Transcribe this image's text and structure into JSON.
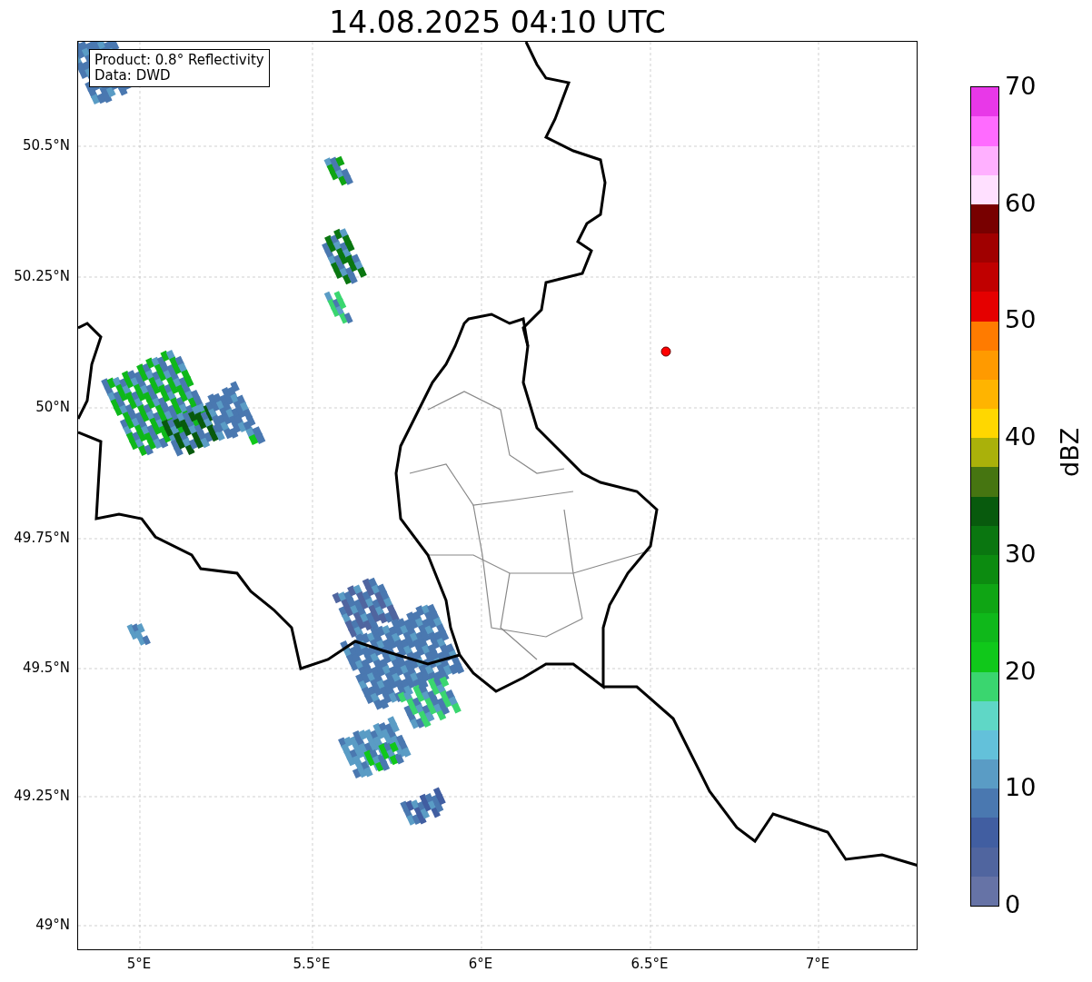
{
  "title": "14.08.2025 04:10 UTC",
  "info_box": [
    "Product: 0.8° Reflectivity",
    "Data: DWD"
  ],
  "y_ticks": [
    "50.5°N",
    "50.25°N",
    "50°N",
    "49.75°N",
    "49.5°N",
    "49.25°N",
    "49°N"
  ],
  "x_ticks": [
    "5°E",
    "5.5°E",
    "6°E",
    "6.5°E",
    "7°E"
  ],
  "colorbar": {
    "label": "dBZ",
    "ticks": [
      "70",
      "60",
      "50",
      "40",
      "30",
      "20",
      "10",
      "0"
    ],
    "segments": [
      {
        "color": "#6673a6"
      },
      {
        "color": "#50659f"
      },
      {
        "color": "#415ea1"
      },
      {
        "color": "#4a78b0"
      },
      {
        "color": "#5a9cc5"
      },
      {
        "color": "#63c1da"
      },
      {
        "color": "#5fd7c6"
      },
      {
        "color": "#3ad66f"
      },
      {
        "color": "#10c81a"
      },
      {
        "color": "#0fb81a"
      },
      {
        "color": "#0fa514"
      },
      {
        "color": "#0c8b10"
      },
      {
        "color": "#0a7610"
      },
      {
        "color": "#085a0d"
      },
      {
        "color": "#467511"
      },
      {
        "color": "#aab10a"
      },
      {
        "color": "#ffd700"
      },
      {
        "color": "#ffb400"
      },
      {
        "color": "#ff9a00"
      },
      {
        "color": "#ff7b00"
      },
      {
        "color": "#e50000"
      },
      {
        "color": "#c00000"
      },
      {
        "color": "#a00000"
      },
      {
        "color": "#780000"
      },
      {
        "color": "#ffe0ff"
      },
      {
        "color": "#ffb0ff"
      },
      {
        "color": "#ff6bff"
      },
      {
        "color": "#e838e8"
      }
    ]
  }
}
